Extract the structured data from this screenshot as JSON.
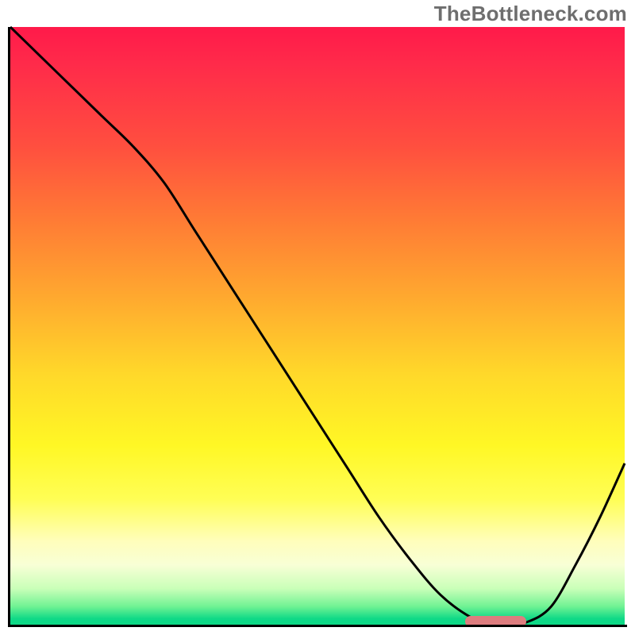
{
  "watermark": "TheBottleneck.com",
  "colors": {
    "axis": "#000000",
    "curve": "#000000",
    "marker": "#de7d7f",
    "gradient_top": "#ff1a4a",
    "gradient_bottom": "#0dd986"
  },
  "chart_data": {
    "type": "line",
    "title": "",
    "xlabel": "",
    "ylabel": "",
    "xlim": [
      0,
      100
    ],
    "ylim": [
      0,
      100
    ],
    "grid": false,
    "legend": false,
    "x": [
      0,
      5,
      10,
      15,
      20,
      25,
      30,
      35,
      40,
      45,
      50,
      55,
      60,
      65,
      70,
      75,
      78,
      81,
      84,
      88,
      92,
      96,
      100
    ],
    "y": [
      100,
      95,
      90,
      85,
      80,
      74,
      66,
      58,
      50,
      42,
      34,
      26,
      18,
      11,
      5,
      1.2,
      0.3,
      0.2,
      0.4,
      3,
      10,
      18,
      27
    ],
    "optimal_range_x": [
      74,
      84
    ],
    "annotations": []
  }
}
